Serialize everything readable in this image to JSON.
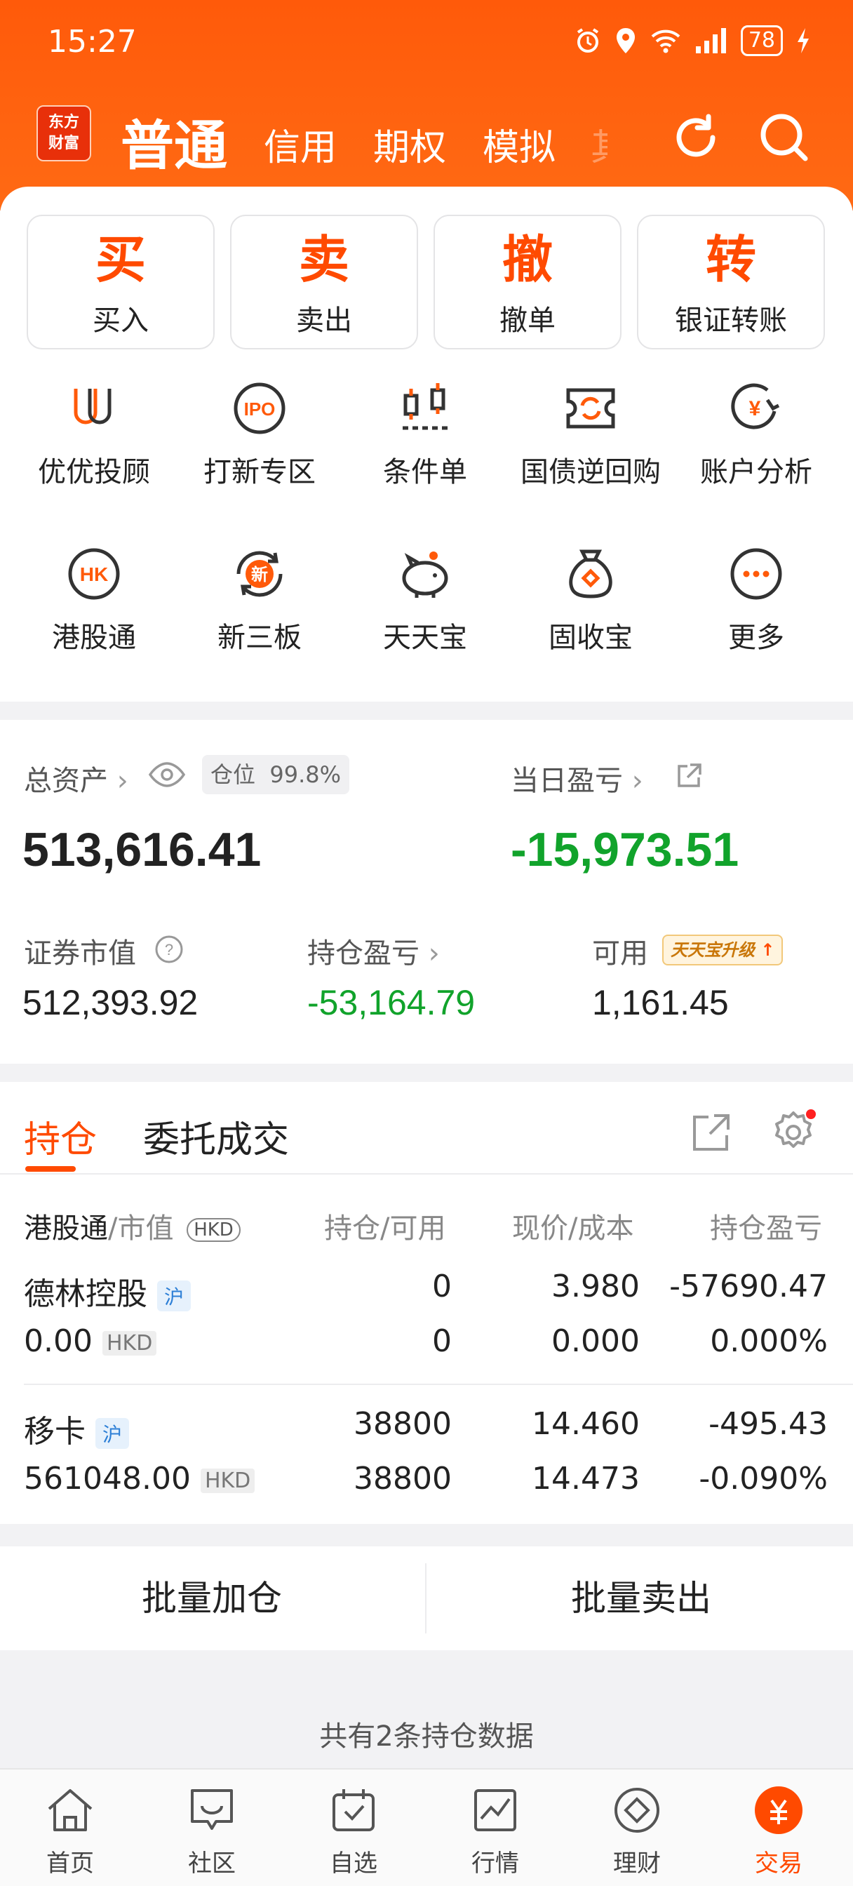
{
  "status_bar": {
    "time": "15:27",
    "battery": "78"
  },
  "header": {
    "logo_line1": "东方",
    "logo_line2": "财富",
    "tabs": [
      "普通",
      "信用",
      "期权",
      "模拟",
      "其"
    ]
  },
  "quick_actions": [
    {
      "glyph": "买",
      "label": "买入"
    },
    {
      "glyph": "卖",
      "label": "卖出"
    },
    {
      "glyph": "撤",
      "label": "撤单"
    },
    {
      "glyph": "转",
      "label": "银证转账"
    }
  ],
  "grid": [
    {
      "label": "优优投顾",
      "icon": "uu-advisor-icon"
    },
    {
      "label": "打新专区",
      "icon": "ipo-icon"
    },
    {
      "label": "条件单",
      "icon": "condition-order-icon"
    },
    {
      "label": "国债逆回购",
      "icon": "reverse-repo-icon"
    },
    {
      "label": "账户分析",
      "icon": "account-analysis-icon"
    },
    {
      "label": "港股通",
      "icon": "hk-connect-icon"
    },
    {
      "label": "新三板",
      "icon": "neeq-icon"
    },
    {
      "label": "天天宝",
      "icon": "piggy-bank-icon"
    },
    {
      "label": "固收宝",
      "icon": "money-bag-icon"
    },
    {
      "label": "更多",
      "icon": "more-icon"
    }
  ],
  "assets": {
    "total_label": "总资产",
    "position_label": "仓位",
    "position_value": "99.8%",
    "total_value": "513,616.41",
    "daily_pl_label": "当日盈亏",
    "daily_pl_value": "-15,973.51",
    "market_value_label": "证券市值",
    "market_value": "512,393.92",
    "holding_pl_label": "持仓盈亏",
    "holding_pl_value": "-53,164.79",
    "available_label": "可用",
    "upgrade_badge": "天天宝升级",
    "available_value": "1,161.45"
  },
  "holdings": {
    "tabs": [
      "持仓",
      "委托成交"
    ],
    "headers": {
      "name": "港股通",
      "name_sub": "/市值",
      "currency": "HKD",
      "qty": "持仓/可用",
      "price": "现价/成本",
      "pl": "持仓盈亏"
    },
    "rows": [
      {
        "name": "德林控股",
        "market": "沪",
        "market_value": "0.00",
        "currency": "HKD",
        "qty": "0",
        "avail": "0",
        "price": "3.980",
        "cost": "0.000",
        "pl": "-57690.47",
        "pl_pct": "0.000%"
      },
      {
        "name": "移卡",
        "market": "沪",
        "market_value": "561048.00",
        "currency": "HKD",
        "qty": "38800",
        "avail": "38800",
        "price": "14.460",
        "cost": "14.473",
        "pl": "-495.43",
        "pl_pct": "-0.090%"
      }
    ]
  },
  "bulk_actions": {
    "add": "批量加仓",
    "sell": "批量卖出"
  },
  "footer_note": "共有2条持仓数据",
  "bottom_nav": [
    {
      "label": "首页",
      "icon": "home-icon"
    },
    {
      "label": "社区",
      "icon": "community-icon"
    },
    {
      "label": "自选",
      "icon": "watchlist-icon"
    },
    {
      "label": "行情",
      "icon": "market-icon"
    },
    {
      "label": "理财",
      "icon": "wealth-icon"
    },
    {
      "label": "交易",
      "icon": "trade-icon"
    }
  ],
  "colors": {
    "brand": "#ff5a0a",
    "accent": "#ff4a00",
    "loss": "#11a32b"
  }
}
